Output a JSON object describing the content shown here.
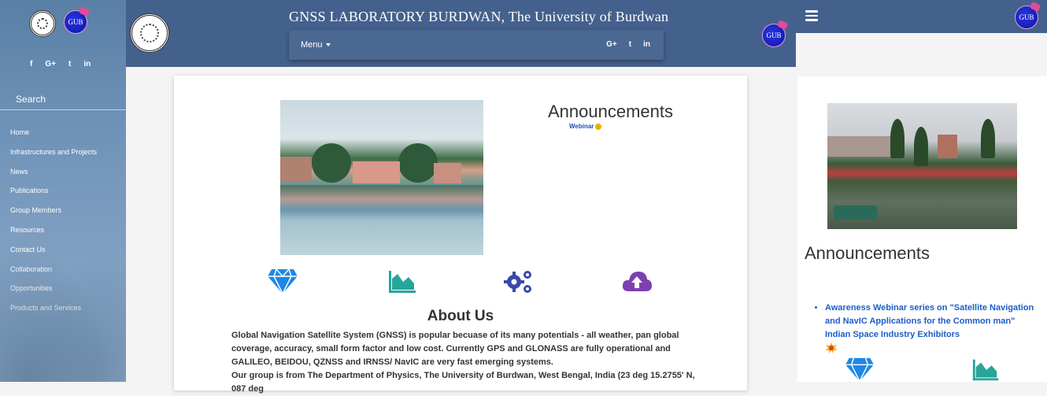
{
  "sidebar": {
    "social": [
      "f",
      "G+",
      "t",
      "in"
    ],
    "search_label": "Search",
    "nav": [
      "Home",
      "Infrastructures and Projects",
      "News",
      "Publications",
      "Group Members",
      "Resources",
      "Contact Us",
      "Collaboration",
      "Opportunities",
      "Products and Services"
    ]
  },
  "header": {
    "title": "GNSS LABORATORY BURDWAN, The University of Burdwan",
    "menu_label": "Menu",
    "social": [
      "G+",
      "t",
      "in"
    ],
    "logo_text": "GUB"
  },
  "main": {
    "announcements_title": "Announcements",
    "announcement_stub": "Webinar",
    "about_title": "About Us",
    "about_paragraph_1": "Global Navigation Satellite System (GNSS) is popular becuase of its many potentials - all weather, pan global coverage, accuracy, small form factor and low cost. Currently GPS and GLONASS are fully operational and GALILEO, BEIDOU, QZNSS and IRNSS/ NavIC are very fast emerging systems.",
    "about_paragraph_2": "Our group is from The Department of Physics, The University of Burdwan, West Bengal, India (23 deg 15.2755' N, 087 deg",
    "feature_icons": [
      "diamond-icon",
      "area-chart-icon",
      "cogs-icon",
      "cloud-upload-icon"
    ]
  },
  "right_panel": {
    "announcements_title": "Announcements",
    "announcement_item": "Awareness Webinar series on \"Satellite Navigation and NavIC Applications for the Common man\" Indian Space Industry Exhibitors"
  },
  "colors": {
    "header_bg": "#44618d",
    "accent_blue": "#1a5fc8",
    "diamond": "#1e88e5",
    "chart": "#26a69a",
    "cogs": "#3949ab",
    "cloud": "#7e3fb0"
  }
}
